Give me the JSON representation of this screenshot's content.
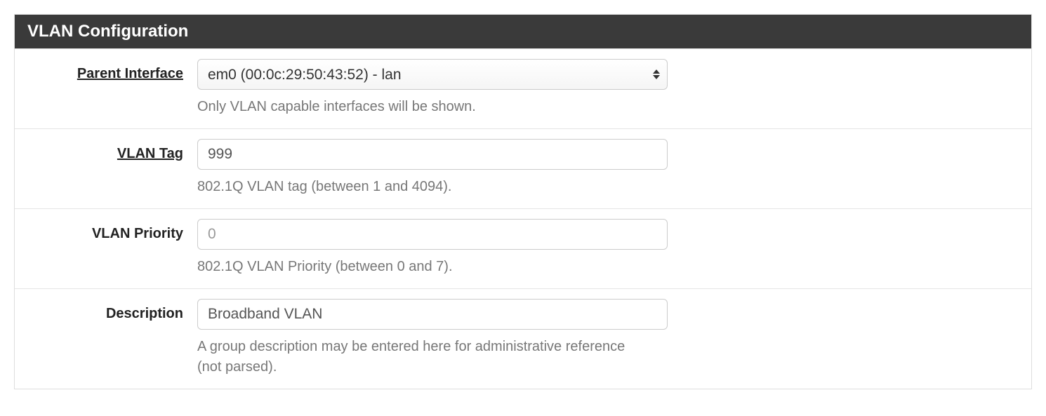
{
  "panel": {
    "title": "VLAN Configuration"
  },
  "fields": {
    "parent_interface": {
      "label": "Parent Interface",
      "selected": "em0 (00:0c:29:50:43:52) - lan",
      "help": "Only VLAN capable interfaces will be shown."
    },
    "vlan_tag": {
      "label": "VLAN Tag",
      "value": "999",
      "help": "802.1Q VLAN tag (between 1 and 4094)."
    },
    "vlan_priority": {
      "label": "VLAN Priority",
      "placeholder": "0",
      "value": "",
      "help": "802.1Q VLAN Priority (between 0 and 7)."
    },
    "description": {
      "label": "Description",
      "value": "Broadband VLAN",
      "help": "A group description may be entered here for administrative reference (not parsed)."
    }
  }
}
